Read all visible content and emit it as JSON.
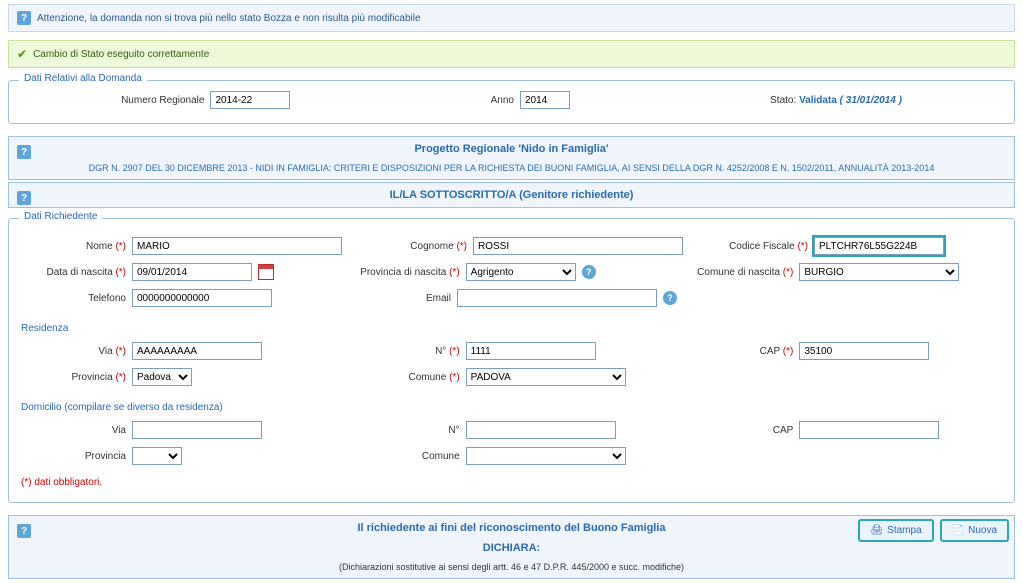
{
  "alerts": {
    "info": "Attenzione, la domanda non si trova più nello stato Bozza e non risulta più modificabile",
    "success": "Cambio di Stato eseguito correttamente"
  },
  "domanda": {
    "legend": "Dati Relativi alla Domanda",
    "num_reg_label": "Numero Regionale",
    "num_reg": "2014-22",
    "anno_label": "Anno",
    "anno": "2014",
    "stato_label": "Stato:",
    "stato_value": "Validata",
    "stato_date": "( 31/01/2014 )"
  },
  "progetto": {
    "title": "Progetto Regionale 'Nido in Famiglia'",
    "sub": "DGR N. 2907 DEL 30 DICEMBRE 2013 - NIDI IN FAMIGLIA: CRITERI E DISPOSIZIONI PER LA RICHIESTA DEI BUONI FAMIGLIA, AI SENSI DELLA DGR N. 4252/2008 E N. 1502/2011, ANNUALITÀ 2013-2014"
  },
  "sottoscritto": {
    "title": "IL/LA SOTTOSCRITTO/A (Genitore richiedente)"
  },
  "richiedente": {
    "legend": "Dati Richiedente",
    "nome_label": "Nome",
    "nome": "MARIO",
    "cognome_label": "Cognome",
    "cognome": "ROSSI",
    "cf_label": "Codice Fiscale",
    "cf": "PLTCHR76L55G224B",
    "data_nascita_label": "Data di nascita",
    "data_nascita": "09/01/2014",
    "prov_nascita_label": "Provincia di nascita",
    "prov_nascita": "Agrigento",
    "comune_nascita_label": "Comune di nascita",
    "comune_nascita": "BURGIO",
    "telefono_label": "Telefono",
    "telefono": "0000000000000",
    "email_label": "Email",
    "email": ""
  },
  "residenza": {
    "legend": "Residenza",
    "via_label": "Via",
    "via": "AAAAAAAAA",
    "n_label": "N°",
    "n": "1111",
    "cap_label": "CAP",
    "cap": "35100",
    "provincia_label": "Provincia",
    "provincia": "Padova",
    "comune_label": "Comune",
    "comune": "PADOVA"
  },
  "domicilio": {
    "legend": "Domicilio (compilare se diverso da residenza)",
    "via_label": "Via",
    "via": "",
    "n_label": "N°",
    "n": "",
    "cap_label": "CAP",
    "cap": "",
    "provincia_label": "Provincia",
    "comune_label": "Comune"
  },
  "mandatory_note": "(*) dati obbligatori.",
  "dichiara": {
    "title": "Il richiedente ai fini del riconoscimento del Buono Famiglia",
    "sub": "DICHIARA:",
    "note": "(Dichiarazioni sostitutive ai sensi degli artt. 46 e 47 D.P.R. 445/2000 e succ. modifiche)"
  },
  "buttons": {
    "stampa": "Stampa",
    "nuova": "Nuova"
  },
  "req": "(*)"
}
